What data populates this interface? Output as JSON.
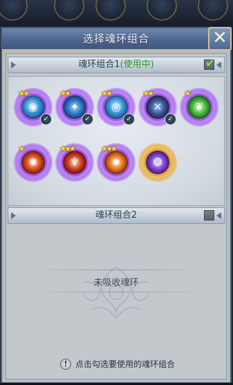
{
  "dialog": {
    "title": "选择魂环组合",
    "close_glyph": "✕"
  },
  "sets": [
    {
      "label_prefix": "魂环组合1",
      "status": "(使用中)",
      "checked": true,
      "rings": [
        {
          "stars": "★★",
          "color": "purple",
          "icon": "blue-orb-icon",
          "badge": "✓"
        },
        {
          "stars": "★★",
          "color": "purple",
          "icon": "blue-claw-icon",
          "badge": "✓"
        },
        {
          "stars": "★★",
          "color": "purple",
          "icon": "blue-swirl-icon",
          "badge": "✓"
        },
        {
          "stars": "★★",
          "color": "purple",
          "icon": "dark-sword-icon",
          "badge": "✓"
        },
        {
          "stars": "★",
          "color": "purple",
          "icon": "green-leaf-icon",
          "badge": ""
        },
        {
          "stars": "★",
          "color": "purple",
          "icon": "flame-tentacle-icon",
          "badge": ""
        },
        {
          "stars": "★★★",
          "color": "purple",
          "icon": "red-beast-icon",
          "badge": ""
        },
        {
          "stars": "★★★",
          "color": "purple",
          "icon": "fire-burst-icon",
          "badge": ""
        },
        {
          "stars": "",
          "color": "gold",
          "icon": "purple-dragon-icon",
          "badge": ""
        }
      ]
    },
    {
      "label": "魂环组合2",
      "checked": false,
      "empty_text": "未吸收魂环"
    }
  ],
  "hint": {
    "icon": "warning-icon",
    "text": "点击勾选要使用的魂环组合"
  }
}
